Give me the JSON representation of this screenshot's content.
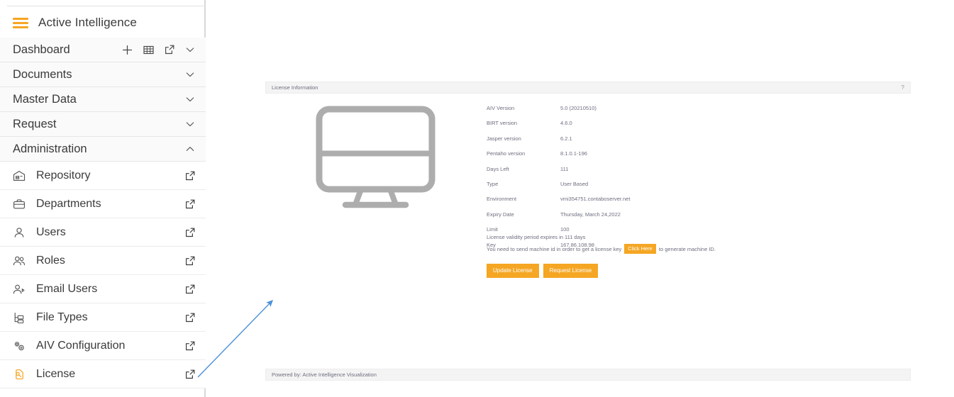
{
  "brand": {
    "title": "Active Intelligence",
    "menu_icon": "hamburger-icon",
    "accent": "#f5a623"
  },
  "sidebar": {
    "groups": [
      {
        "label": "Dashboard",
        "expanded": false,
        "chevron": "chevron-down-icon",
        "tools": [
          "plus-icon",
          "grid-icon",
          "external-link-icon"
        ]
      },
      {
        "label": "Documents",
        "expanded": false,
        "chevron": "chevron-down-icon",
        "tools": []
      },
      {
        "label": "Master Data",
        "expanded": false,
        "chevron": "chevron-down-icon",
        "tools": []
      },
      {
        "label": "Request",
        "expanded": false,
        "chevron": "chevron-down-icon",
        "tools": []
      },
      {
        "label": "Administration",
        "expanded": true,
        "chevron": "chevron-up-icon",
        "tools": []
      }
    ],
    "items": [
      {
        "label": "Repository",
        "icon": "warehouse-icon",
        "action": "external-link-icon",
        "active": false
      },
      {
        "label": "Departments",
        "icon": "briefcase-icon",
        "action": "external-link-icon",
        "active": false
      },
      {
        "label": "Users",
        "icon": "user-icon",
        "action": "external-link-icon",
        "active": false
      },
      {
        "label": "Roles",
        "icon": "users-icon",
        "action": "external-link-icon",
        "active": false
      },
      {
        "label": "Email Users",
        "icon": "user-tag-icon",
        "action": "external-link-icon",
        "active": false
      },
      {
        "label": "File Types",
        "icon": "file-tree-icon",
        "action": "external-link-icon",
        "active": false
      },
      {
        "label": "AIV Configuration",
        "icon": "gears-icon",
        "action": "external-link-icon",
        "active": false
      },
      {
        "label": "License",
        "icon": "license-key-icon",
        "action": "external-link-icon",
        "active": true
      }
    ]
  },
  "panel": {
    "title": "License Information",
    "help": "?",
    "illustration": "desktop-monitor-icon",
    "info": [
      {
        "key": "AIV Version",
        "value": "5.0 (20210510)"
      },
      {
        "key": "BIRT version",
        "value": "4.6.0"
      },
      {
        "key": "Jasper version",
        "value": "6.2.1"
      },
      {
        "key": "Pentaho version",
        "value": "8.1.0.1-196"
      },
      {
        "key": "Days Left",
        "value": "111"
      },
      {
        "key": "Type",
        "value": "User Based"
      },
      {
        "key": "Environment",
        "value": "vmi354751.contaboserver.net"
      },
      {
        "key": "Expiry Date",
        "value": "Thursday, March 24,2022"
      },
      {
        "key": "Limit",
        "value": "100"
      },
      {
        "key": "Key",
        "value": "167.86.108.98"
      }
    ],
    "notice_line1": "License validity period expires in 111 days",
    "notice_before": "You need to send machine id in order to get a license key",
    "notice_chip": "Click Here",
    "notice_after": "to generate machine ID.",
    "buttons": [
      {
        "label": "Update License"
      },
      {
        "label": "Request License"
      }
    ]
  },
  "footer": {
    "text": "Powered by: Active Intelligence Visualization"
  },
  "annotation": {
    "type": "arrow",
    "color": "#4a90d9",
    "points_to": "sidebar-item-license"
  }
}
